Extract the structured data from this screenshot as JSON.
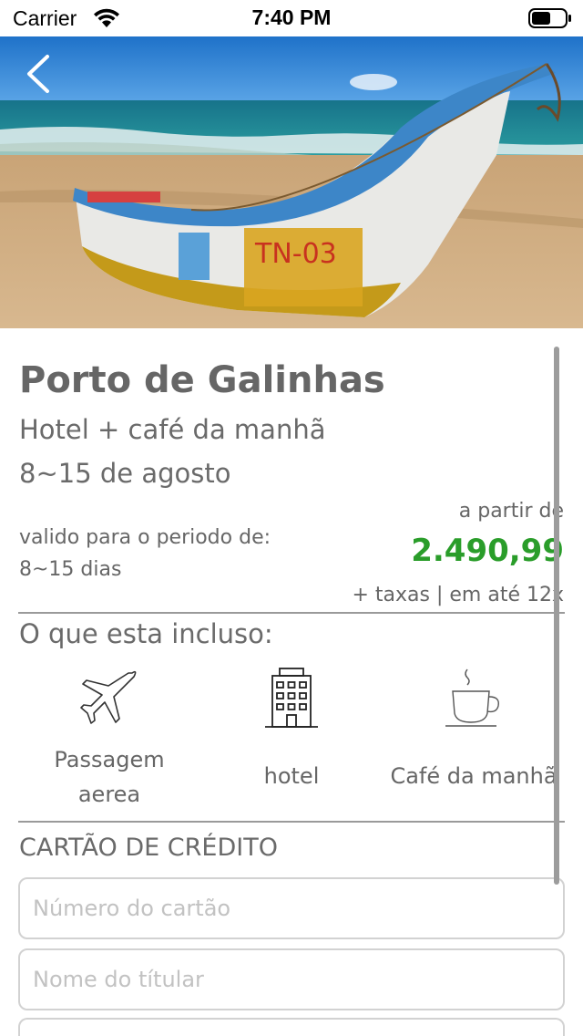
{
  "status_bar": {
    "carrier": "Carrier",
    "time": "7:40 PM"
  },
  "hero": {
    "image": "beach-boat-photo",
    "back_icon": "chevron-left-icon"
  },
  "offer": {
    "title": "Porto de Galinhas",
    "subtitle": "Hotel + café da manhã",
    "dates": "8~15 de agosto",
    "valid_label": "valido para o periodo de:",
    "valid_value": "8~15 dias",
    "price_from": "a partir de",
    "price": "2.490,99",
    "price_note": "+ taxas | em até 12x",
    "price_color": "#2a9d2a"
  },
  "included": {
    "title": "O que esta incluso:",
    "items": [
      {
        "icon": "airplane-icon",
        "label_line1": "Passagem",
        "label_line2": "aerea"
      },
      {
        "icon": "hotel-building-icon",
        "label_line1": "hotel"
      },
      {
        "icon": "coffee-cup-icon",
        "label_line1": "Café da manhã"
      }
    ]
  },
  "credit_card": {
    "title": "CARTÃO DE CRÉDITO",
    "card_number_placeholder": "Número do cartão",
    "holder_name_placeholder": "Nome do títular"
  }
}
